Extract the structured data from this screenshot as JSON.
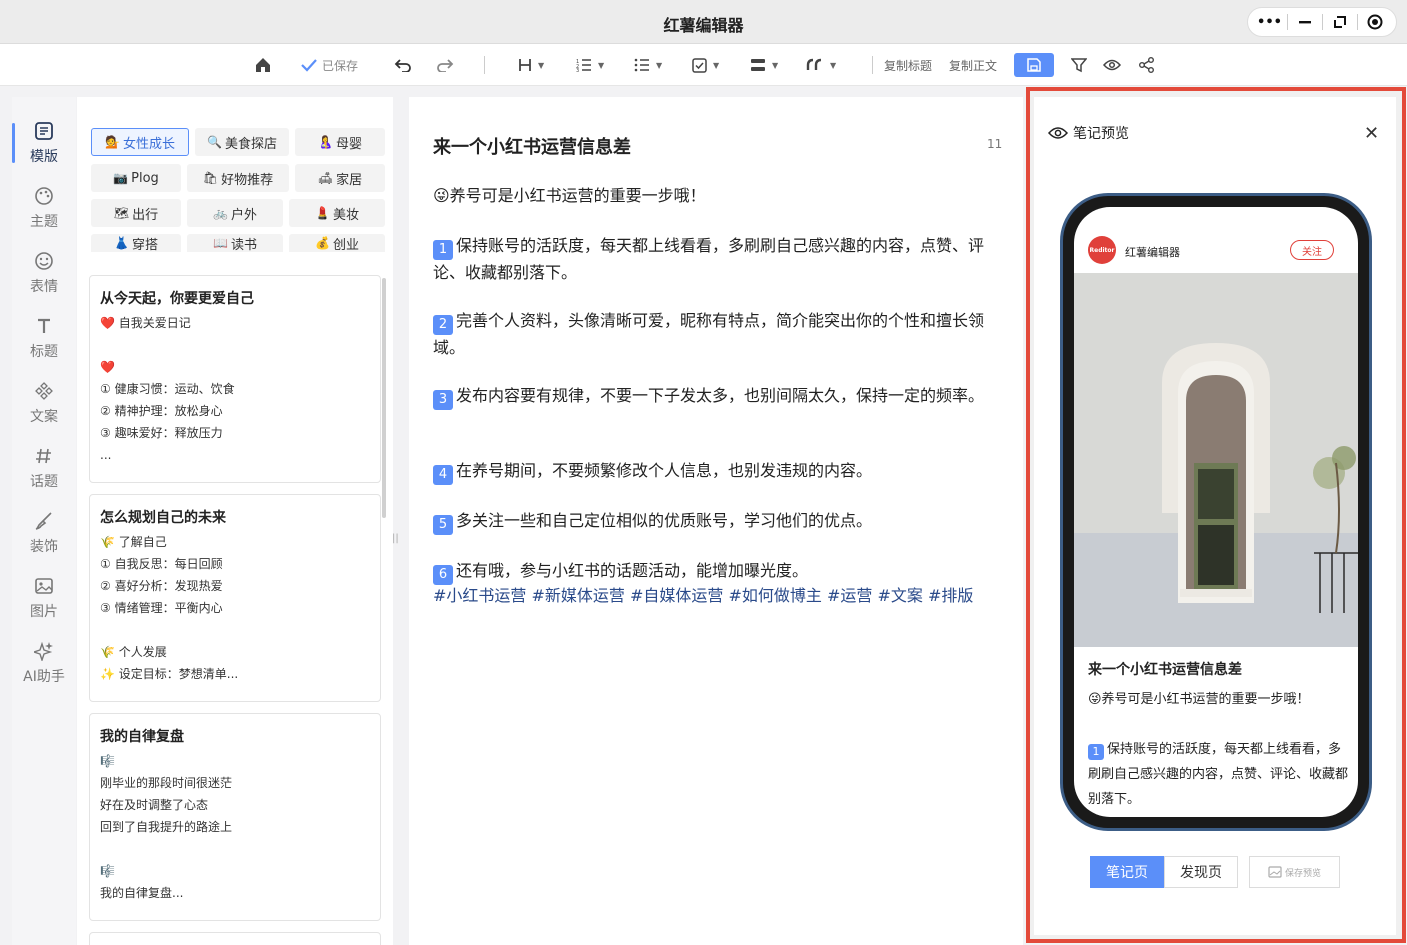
{
  "app": {
    "title": "红薯编辑器"
  },
  "toolbar": {
    "saved_label": "已保存",
    "copy_title": "复制标题",
    "copy_body": "复制正文"
  },
  "nav": [
    {
      "label": "模版",
      "icon": "template-icon"
    },
    {
      "label": "主题",
      "icon": "palette-icon"
    },
    {
      "label": "表情",
      "icon": "emoji-icon"
    },
    {
      "label": "标题",
      "icon": "heading-icon"
    },
    {
      "label": "文案",
      "icon": "copywriting-icon"
    },
    {
      "label": "话题",
      "icon": "hashtag-icon"
    },
    {
      "label": "装饰",
      "icon": "brush-icon"
    },
    {
      "label": "图片",
      "icon": "image-icon"
    },
    {
      "label": "AI助手",
      "icon": "sparkle-icon"
    }
  ],
  "categories": [
    {
      "emoji": "💁",
      "label": "女性成长"
    },
    {
      "emoji": "🔍",
      "label": "美食探店"
    },
    {
      "emoji": "🤱",
      "label": "母婴"
    },
    {
      "emoji": "📷",
      "label": "Plog"
    },
    {
      "emoji": "🛍",
      "label": "好物推荐"
    },
    {
      "emoji": "🛋",
      "label": "家居"
    },
    {
      "emoji": "🗺",
      "label": "出行"
    },
    {
      "emoji": "🚲",
      "label": "户外"
    },
    {
      "emoji": "💄",
      "label": "美妆"
    },
    {
      "emoji": "👗",
      "label": "穿搭"
    },
    {
      "emoji": "📖",
      "label": "读书"
    },
    {
      "emoji": "💰",
      "label": "创业"
    }
  ],
  "templates": [
    {
      "title": "从今天起，你要更爱自己",
      "lines": [
        "❤️ 自我关爱日记",
        "",
        "❤️",
        "① 健康习惯：运动、饮食",
        "② 精神护理：放松身心",
        "③ 趣味爱好：释放压力",
        "..."
      ]
    },
    {
      "title": "怎么规划自己的未来",
      "lines": [
        "🌾 了解自己",
        "① 自我反思：每日回顾",
        "② 喜好分析：发现热爱",
        "③ 情绪管理：平衡内心",
        "",
        "🌾 个人发展",
        "✨ 设定目标：梦想清单..."
      ]
    },
    {
      "title": "我的自律复盘",
      "lines": [
        "🎼",
        "刚毕业的那段时间很迷茫",
        "好在及时调整了心态",
        "回到了自我提升的路途上",
        "",
        "🎼",
        "我的自律复盘..."
      ]
    }
  ],
  "editor": {
    "title": "来一个小红书运营信息差",
    "char_count": "11",
    "intro": "😜养号可是小红书运营的重要一步哦！",
    "points": [
      {
        "n": "1",
        "text": "保持账号的活跃度，每天都上线看看，多刷刷自己感兴趣的内容，点赞、评论、收藏都别落下。"
      },
      {
        "n": "2",
        "text": "完善个人资料，头像清晰可爱，昵称有特点，简介能突出你的个性和擅长领域。"
      },
      {
        "n": "3",
        "text": "发布内容要有规律，不要一下子发太多，也别间隔太久，保持一定的频率。"
      },
      {
        "n": "4",
        "text": "在养号期间，不要频繁修改个人信息，也别发违规的内容。"
      },
      {
        "n": "5",
        "text": "多关注一些和自己定位相似的优质账号，学习他们的优点。"
      },
      {
        "n": "6",
        "text": "还有哦，参与小红书的话题活动，能增加曝光度。"
      }
    ],
    "hashtags": "#小红书运营 #新媒体运营 #自媒体运营 #如何做博主 #运营  #文案 #排版"
  },
  "preview": {
    "header": "笔记预览",
    "avatar_text": "Reditor",
    "author": "红薯编辑器",
    "follow": "关注",
    "note_title": "来一个小红书运营信息差",
    "intro": "😜养号可是小红书运营的重要一步哦！",
    "point1_num": "1",
    "point1": "保持账号的活跃度，每天都上线看看，多刷刷自己感兴趣的内容，点赞、评论、收藏都别落下。",
    "tab_note": "笔记页",
    "tab_discover": "发现页",
    "save_preview": "保存预览"
  }
}
